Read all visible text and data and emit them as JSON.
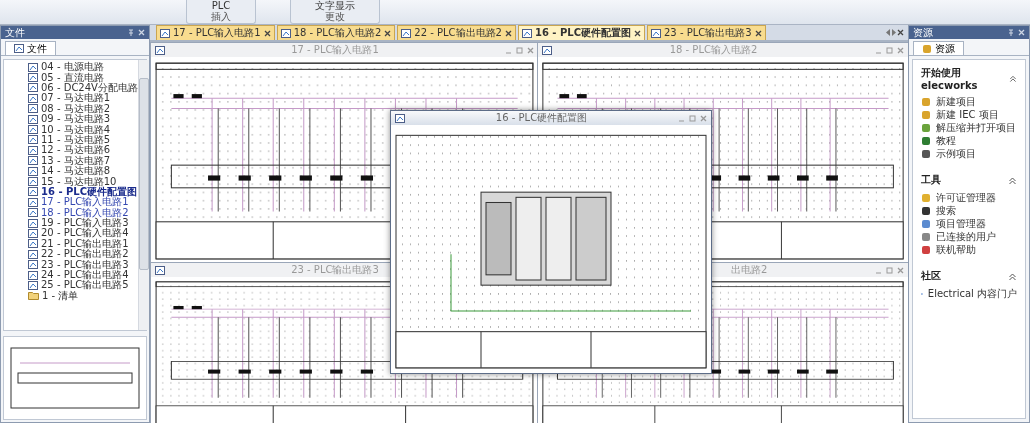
{
  "ribbon": {
    "groups": [
      {
        "label": "插入",
        "buttons": [
          "PLC"
        ]
      },
      {
        "label": "更改",
        "buttons": [
          "文字显示"
        ]
      }
    ]
  },
  "doc_tabs": [
    {
      "label": "17 - PLC输入电路1",
      "selected": false
    },
    {
      "label": "18 - PLC输入电路2",
      "selected": false
    },
    {
      "label": "22 - PLC输出电路2",
      "selected": false
    },
    {
      "label": "16 - PLC硬件配置图",
      "selected": true
    },
    {
      "label": "23 - PLC输出电路3",
      "selected": false
    }
  ],
  "file_panel": {
    "title": "文件",
    "tab": "文件",
    "items": [
      {
        "label": "04 - 电源电路",
        "selected": false,
        "open": false,
        "kind": "page"
      },
      {
        "label": "05 - 直流电路",
        "selected": false,
        "open": false,
        "kind": "page"
      },
      {
        "label": "06 - DC24V分配电路",
        "selected": false,
        "open": false,
        "kind": "page"
      },
      {
        "label": "07 - 马达电路1",
        "selected": false,
        "open": false,
        "kind": "page"
      },
      {
        "label": "08 - 马达电路2",
        "selected": false,
        "open": false,
        "kind": "page"
      },
      {
        "label": "09 - 马达电路3",
        "selected": false,
        "open": false,
        "kind": "page"
      },
      {
        "label": "10 - 马达电路4",
        "selected": false,
        "open": false,
        "kind": "page"
      },
      {
        "label": "11 - 马达电路5",
        "selected": false,
        "open": false,
        "kind": "page"
      },
      {
        "label": "12 - 马达电路6",
        "selected": false,
        "open": false,
        "kind": "page"
      },
      {
        "label": "13 - 马达电路7",
        "selected": false,
        "open": false,
        "kind": "page"
      },
      {
        "label": "14 - 马达电路8",
        "selected": false,
        "open": false,
        "kind": "page"
      },
      {
        "label": "15 - 马达电路10",
        "selected": false,
        "open": false,
        "kind": "page"
      },
      {
        "label": "16 - PLC硬件配置图",
        "selected": true,
        "open": true,
        "kind": "page"
      },
      {
        "label": "17 - PLC输入电路1",
        "selected": false,
        "open": true,
        "kind": "page"
      },
      {
        "label": "18 - PLC输入电路2",
        "selected": false,
        "open": true,
        "kind": "page"
      },
      {
        "label": "19 - PLC输入电路3",
        "selected": false,
        "open": false,
        "kind": "page"
      },
      {
        "label": "20 - PLC输入电路4",
        "selected": false,
        "open": false,
        "kind": "page"
      },
      {
        "label": "21 - PLC输出电路1",
        "selected": false,
        "open": false,
        "kind": "page"
      },
      {
        "label": "22 - PLC输出电路2",
        "selected": false,
        "open": false,
        "kind": "page"
      },
      {
        "label": "23 - PLC输出电路3",
        "selected": false,
        "open": false,
        "kind": "page"
      },
      {
        "label": "24 - PLC输出电路4",
        "selected": false,
        "open": false,
        "kind": "page"
      },
      {
        "label": "25 - PLC输出电路5",
        "selected": false,
        "open": false,
        "kind": "page"
      },
      {
        "label": "1 - 清单",
        "selected": false,
        "open": false,
        "kind": "folder"
      }
    ]
  },
  "windows": [
    {
      "title": "17 - PLC输入电路1",
      "kind": "schematic",
      "active": false
    },
    {
      "title": "18 - PLC输入电路2",
      "kind": "schematic",
      "active": false
    },
    {
      "title": "23 - PLC输出电路3",
      "kind": "schematic",
      "active": false
    },
    {
      "title": "出电路2",
      "kind": "schematic",
      "active": false
    },
    {
      "title": "16 - PLC硬件配置图",
      "kind": "hardware",
      "active": true
    }
  ],
  "resources_panel": {
    "title": "资源",
    "tab": "资源",
    "sections": [
      {
        "title": "开始使用 elecworks",
        "expanded": true,
        "items": [
          "新建项目",
          "新建 IEC 项目",
          "解压缩并打开项目",
          "教程",
          "示例项目"
        ]
      },
      {
        "title": "工具",
        "expanded": true,
        "items": [
          "许可证管理器",
          "搜索",
          "项目管理器",
          "已连接的用户",
          "联机帮助"
        ]
      },
      {
        "title": "社区",
        "expanded": true,
        "items": [
          "Electrical 内容门户"
        ]
      }
    ]
  }
}
